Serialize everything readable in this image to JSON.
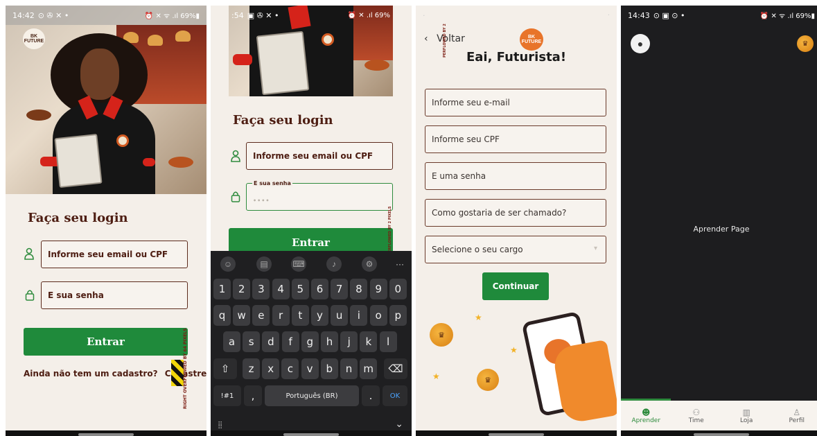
{
  "screen1": {
    "status": {
      "time": "14:42",
      "left_icons": "⊙ ✇ ✕ •",
      "right": "⏰ ✕ ᯤ .ıl 69%▮"
    },
    "brand": "BK FUTURE",
    "login_title": "Faça seu login",
    "email_placeholder": "Informe seu email ou CPF",
    "password_placeholder": "E sua senha",
    "submit_label": "Entrar",
    "signup_prompt": "Ainda não tem um cadastro?",
    "signup_link": "Cadastre-se agora",
    "overflow_warning": "RIGHT OVERFLOWED BY 64 PIXELS"
  },
  "screen2": {
    "status": {
      "time": ":54",
      "left_icons": "▣ ✇ ✕ •",
      "right": "⏰ ✕ .ıl 69%"
    },
    "login_title": "Faça seu login",
    "email_value": "Informe seu email ou CPF",
    "password_label": "E sua senha",
    "password_value": "••••",
    "submit_label": "Entrar",
    "overflow_warning": "OVERFLOWED BY 2 PIXELS",
    "keyboard": {
      "row1": [
        "1",
        "2",
        "3",
        "4",
        "5",
        "6",
        "7",
        "8",
        "9",
        "0"
      ],
      "row2": [
        "q",
        "w",
        "e",
        "r",
        "t",
        "y",
        "u",
        "i",
        "o",
        "p"
      ],
      "row3": [
        "a",
        "s",
        "d",
        "f",
        "g",
        "h",
        "j",
        "k",
        "l"
      ],
      "row4": [
        "z",
        "x",
        "c",
        "v",
        "b",
        "n",
        "m"
      ],
      "symbols_key": "!#1",
      "comma_key": ",",
      "space_label": "Português (BR)",
      "period_key": ".",
      "ok_key": "OK",
      "more_key": "···"
    }
  },
  "screen3": {
    "back_label": "Voltar",
    "overflow_warning": "PERFLOWED BY 2",
    "heading": "Eai, Futurista!",
    "brand": "BK FUTURE",
    "email_placeholder": "Informe seu e-mail",
    "cpf_placeholder": "Informe seu CPF",
    "password_placeholder": "E uma senha",
    "nickname_placeholder": "Como gostaria de ser chamado?",
    "role_placeholder": "Selecione o seu cargo",
    "continue_label": "Continuar"
  },
  "screen4": {
    "status": {
      "time": "14:43",
      "left_icons": "⊙ ▣ ⊙ •",
      "right": "⏰ ✕ ᯤ .ıl 69%▮"
    },
    "page_text": "Aprender Page",
    "tabs": [
      {
        "label": "Aprender",
        "icon": "robot-icon",
        "active": true
      },
      {
        "label": "Time",
        "icon": "team-icon",
        "active": false
      },
      {
        "label": "Loja",
        "icon": "store-icon",
        "active": false
      },
      {
        "label": "Perfil",
        "icon": "person-icon",
        "active": false
      }
    ]
  },
  "colors": {
    "brand_brown": "#4d1d12",
    "accent_green": "#1f8a3b",
    "background_cream": "#f4efe9",
    "dark_bg": "#1d1d1f"
  }
}
